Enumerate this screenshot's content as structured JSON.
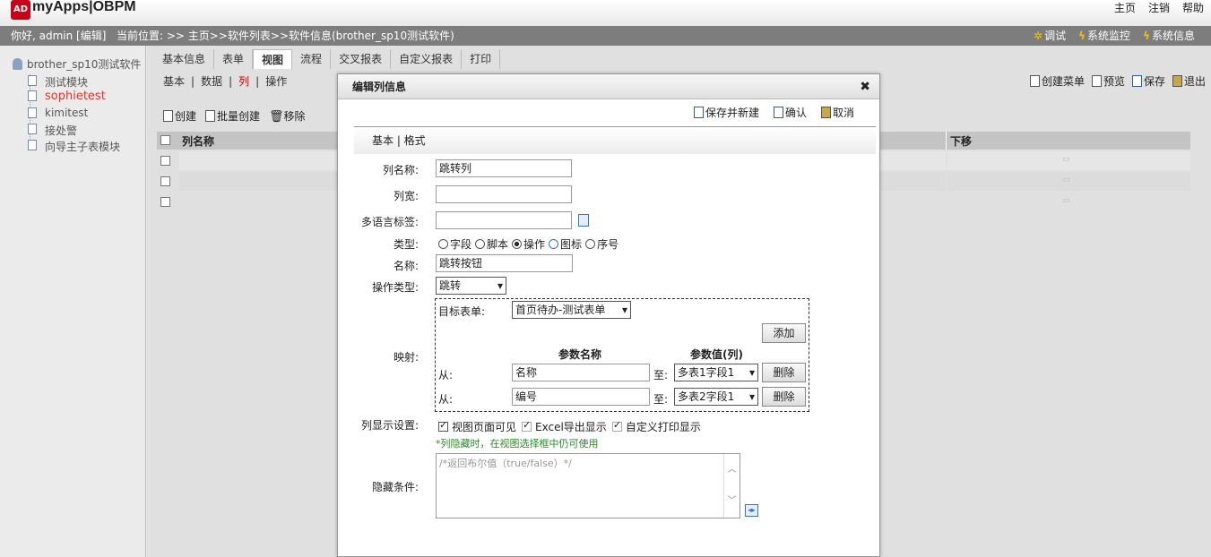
{
  "header": {
    "logo_badge": "AD",
    "logo_text": "myApps|OBPM",
    "links": [
      "主页",
      "注销",
      "帮助"
    ]
  },
  "info_bar": {
    "greeting": "你好, admin [编辑]",
    "breadcrumb": "当前位置: >> 主页>>软件列表>>软件信息(brother_sp10测试软件)",
    "tools": [
      "调试",
      "系统监控",
      "系统信息"
    ]
  },
  "sidebar": {
    "root": "brother_sp10测试软件",
    "items": [
      {
        "label": "测试模块",
        "color": "#555555"
      },
      {
        "label": "sophietest",
        "color": "#e0332e"
      },
      {
        "label": "kimitest",
        "color": "#555555"
      },
      {
        "label": "接处警",
        "color": "#555555"
      },
      {
        "label": "向导主子表模块",
        "color": "#555555"
      }
    ]
  },
  "tabs": [
    "基本信息",
    "表单",
    "视图",
    "流程",
    "交叉报表",
    "自定义报表",
    "打印"
  ],
  "active_tab": "视图",
  "subtabs": {
    "items": [
      "基本",
      "数据",
      "列",
      "操作"
    ],
    "active": "列"
  },
  "right_toolbar": [
    "创建菜单",
    "预览",
    "保存",
    "退出"
  ],
  "list_toolbar": [
    "创建",
    "批量创建",
    "移除"
  ],
  "grid": {
    "col_name": "列名称",
    "col_down": "下移"
  },
  "modal": {
    "title": "编辑列信息",
    "close": "✖",
    "toolbar": [
      "保存并新建",
      "确认",
      "取消"
    ],
    "subnav": "基本 | 格式",
    "labels": {
      "name": "列名称:",
      "width": "列宽:",
      "i18n": "多语言标签:",
      "type": "类型:",
      "action_name": "名称:",
      "action_type": "操作类型:",
      "mapping": "映射:",
      "display": "列显示设置:",
      "hidden": "隐藏条件:"
    },
    "values": {
      "name": "跳转列",
      "width": "",
      "i18n": "",
      "action_name": "跳转按钮",
      "action_type": "跳转"
    },
    "type_options": [
      {
        "label": "字段",
        "checked": false
      },
      {
        "label": "脚本",
        "checked": false
      },
      {
        "label": "操作",
        "checked": true
      },
      {
        "label": "图标",
        "checked": false
      },
      {
        "label": "序号",
        "checked": false
      }
    ],
    "mapping": {
      "target_label": "目标表单:",
      "target_value": "首页待办-测试表单",
      "add_button": "添加",
      "param_name_header": "参数名称",
      "param_value_header": "参数值(列)",
      "rows": [
        {
          "from": "从:",
          "name": "名称",
          "to": "至:",
          "value": "多表1字段1",
          "delete": "删除"
        },
        {
          "from": "从:",
          "name": "编号",
          "to": "至:",
          "value": "多表2字段1",
          "delete": "删除"
        }
      ]
    },
    "display_options": [
      "视图页面可见",
      "Excel导出显示",
      "自定义打印显示"
    ],
    "display_note": "*列隐藏时，在视图选择框中仍可使用",
    "hidden_placeholder": "/*返回布尔值（true/false）*/"
  },
  "colors": {
    "accent_red": "#c8001a",
    "note_green": "#2a8a2a",
    "info_bar": "#7d7d7d"
  }
}
